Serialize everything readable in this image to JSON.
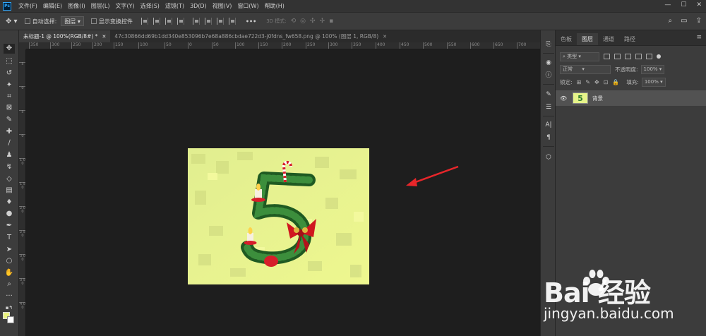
{
  "app": {
    "logo_text": "Ps"
  },
  "menu": [
    "文件(F)",
    "编辑(E)",
    "图像(I)",
    "图层(L)",
    "文字(Y)",
    "选择(S)",
    "滤镜(T)",
    "3D(D)",
    "视图(V)",
    "窗口(W)",
    "帮助(H)"
  ],
  "window_controls": {
    "minimize": "—",
    "maximize": "☐",
    "close": "✕"
  },
  "options": {
    "auto_select_label": "自动选择:",
    "auto_select_value": "图层",
    "show_transform_label": "显示变换控件",
    "mode_3d_label": "3D 模式:",
    "more": "•••"
  },
  "tabs": [
    {
      "label": "未标题-1 @ 100%(RGB/8#) *",
      "active": true
    },
    {
      "label": "47c30866dd69b1dd340e853096b7e68a886cbdae722d3-j0fdns_fw658.png @ 100% (图层 1, RGB/8)",
      "active": false
    }
  ],
  "ruler_h": [
    "350",
    "300",
    "250",
    "200",
    "150",
    "100",
    "50",
    "0",
    "50",
    "100",
    "150",
    "200",
    "250",
    "300",
    "350",
    "400",
    "450",
    "500",
    "550",
    "600",
    "650",
    "700"
  ],
  "ruler_v": [
    "5",
    "0",
    "5",
    "0",
    "1 0 0",
    "1 5 0",
    "2 0 0",
    "2 5 0",
    "3 0 0",
    "3 5 0",
    "4 0 0"
  ],
  "panel": {
    "tabs": [
      "色板",
      "图层",
      "通道",
      "路径"
    ],
    "active_tab": "图层",
    "filter_kind": "类型",
    "blend_mode": "正常",
    "opacity_label": "不透明度:",
    "opacity_value": "100%",
    "lock_label": "锁定:",
    "fill_label": "填充:",
    "fill_value": "100%",
    "layer_name": "背景",
    "layer_thumb_glyph": "5"
  },
  "watermark": {
    "logo": "Bai  经验",
    "url": "jingyan.baidu.com"
  },
  "colors": {
    "foreground": "#e9f27f",
    "background": "#ffffff",
    "arrow": "#e8262a"
  }
}
